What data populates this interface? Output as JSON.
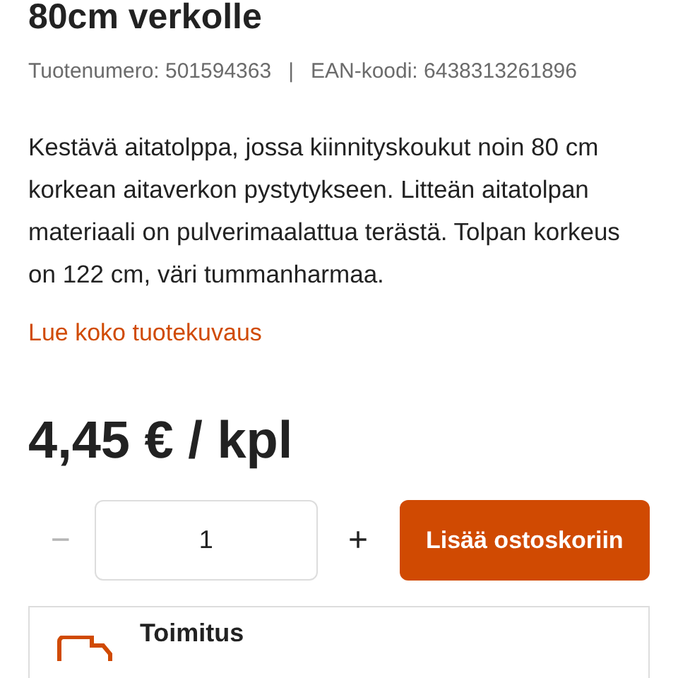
{
  "product": {
    "title": "80cm verkolle",
    "product_number": "Tuotenumero: 501594363",
    "separator": "|",
    "ean": "EAN-koodi: 6438313261896",
    "description": "Kestävä aitatolppa, jossa kiinnityskoukut noin 80 cm korkean aitaverkon pystytykseen. Litteän aitatolpan materiaali on pulverimaalattua terästä. Tolpan korkeus on 122 cm, väri tummanharmaa.",
    "read_more": "Lue koko tuotekuvaus",
    "price": "4,45 € / kpl"
  },
  "quantity": {
    "decrement": "−",
    "decrement_disabled": true,
    "value": "1",
    "increment": "+"
  },
  "add_to_cart": "Lisää ostoskoriin",
  "delivery": {
    "title": "Toimitus"
  }
}
